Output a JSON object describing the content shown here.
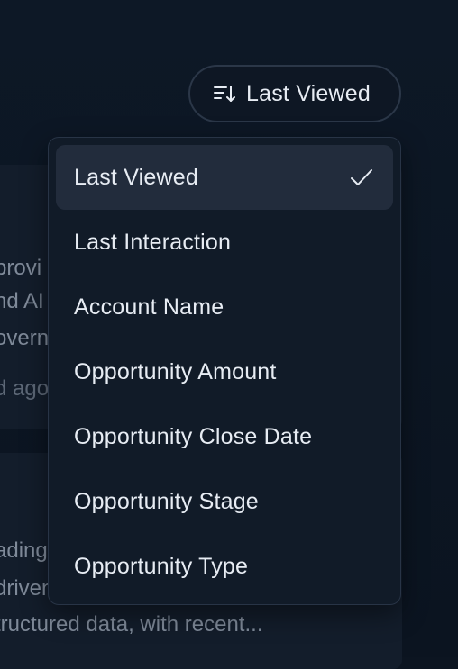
{
  "sort": {
    "button_label": "Last Viewed",
    "button_icon": "sort-descending-icon",
    "options": [
      {
        "label": "Last Viewed",
        "selected": true
      },
      {
        "label": "Last Interaction",
        "selected": false
      },
      {
        "label": "Account Name",
        "selected": false
      },
      {
        "label": "Opportunity Amount",
        "selected": false
      },
      {
        "label": "Opportunity Close Date",
        "selected": false
      },
      {
        "label": "Opportunity Stage",
        "selected": false
      },
      {
        "label": "Opportunity Type",
        "selected": false
      }
    ],
    "check_icon": "checkmark-icon"
  },
  "cards": [
    {
      "lines": [
        "provi",
        "nd AI",
        "overn",
        "d ago"
      ]
    },
    {
      "lines": [
        "ading",
        "driven",
        "tructured data, with recent..."
      ]
    }
  ],
  "colors": {
    "background": "#0c1521",
    "card": "#131d2b",
    "dropdown": "#111b28",
    "selected_item": "#222c3c",
    "text": "#e7ecf3",
    "muted_text": "#7f8a99"
  }
}
